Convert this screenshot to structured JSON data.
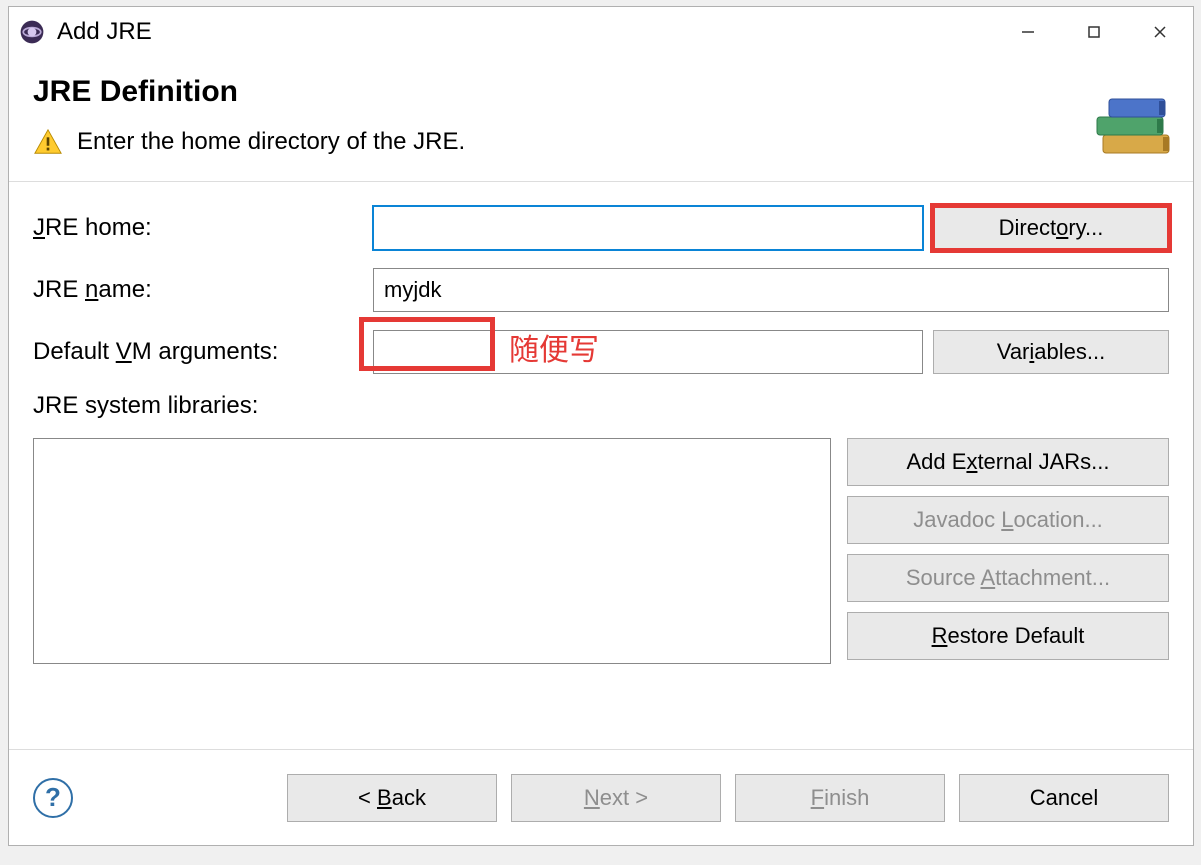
{
  "window": {
    "title": "Add JRE"
  },
  "banner": {
    "title": "JRE Definition",
    "message": "Enter the home directory of the JRE."
  },
  "labels": {
    "jre_home": "JRE home:",
    "jre_name": "JRE name:",
    "default_vm_args": "Default VM arguments:",
    "jre_syslibs": "JRE system libraries:"
  },
  "fields": {
    "jre_home": "",
    "jre_name": "myjdk",
    "default_vm_args": ""
  },
  "buttons": {
    "directory": "Directory...",
    "variables": "Variables...",
    "add_external_jars": "Add External JARs...",
    "javadoc_location": "Javadoc Location...",
    "source_attachment": "Source Attachment...",
    "restore_default": "Restore Default",
    "back": "< Back",
    "next": "Next >",
    "finish": "Finish",
    "cancel": "Cancel"
  },
  "annotations": {
    "jre_name_note": "随便写"
  },
  "libraries": []
}
